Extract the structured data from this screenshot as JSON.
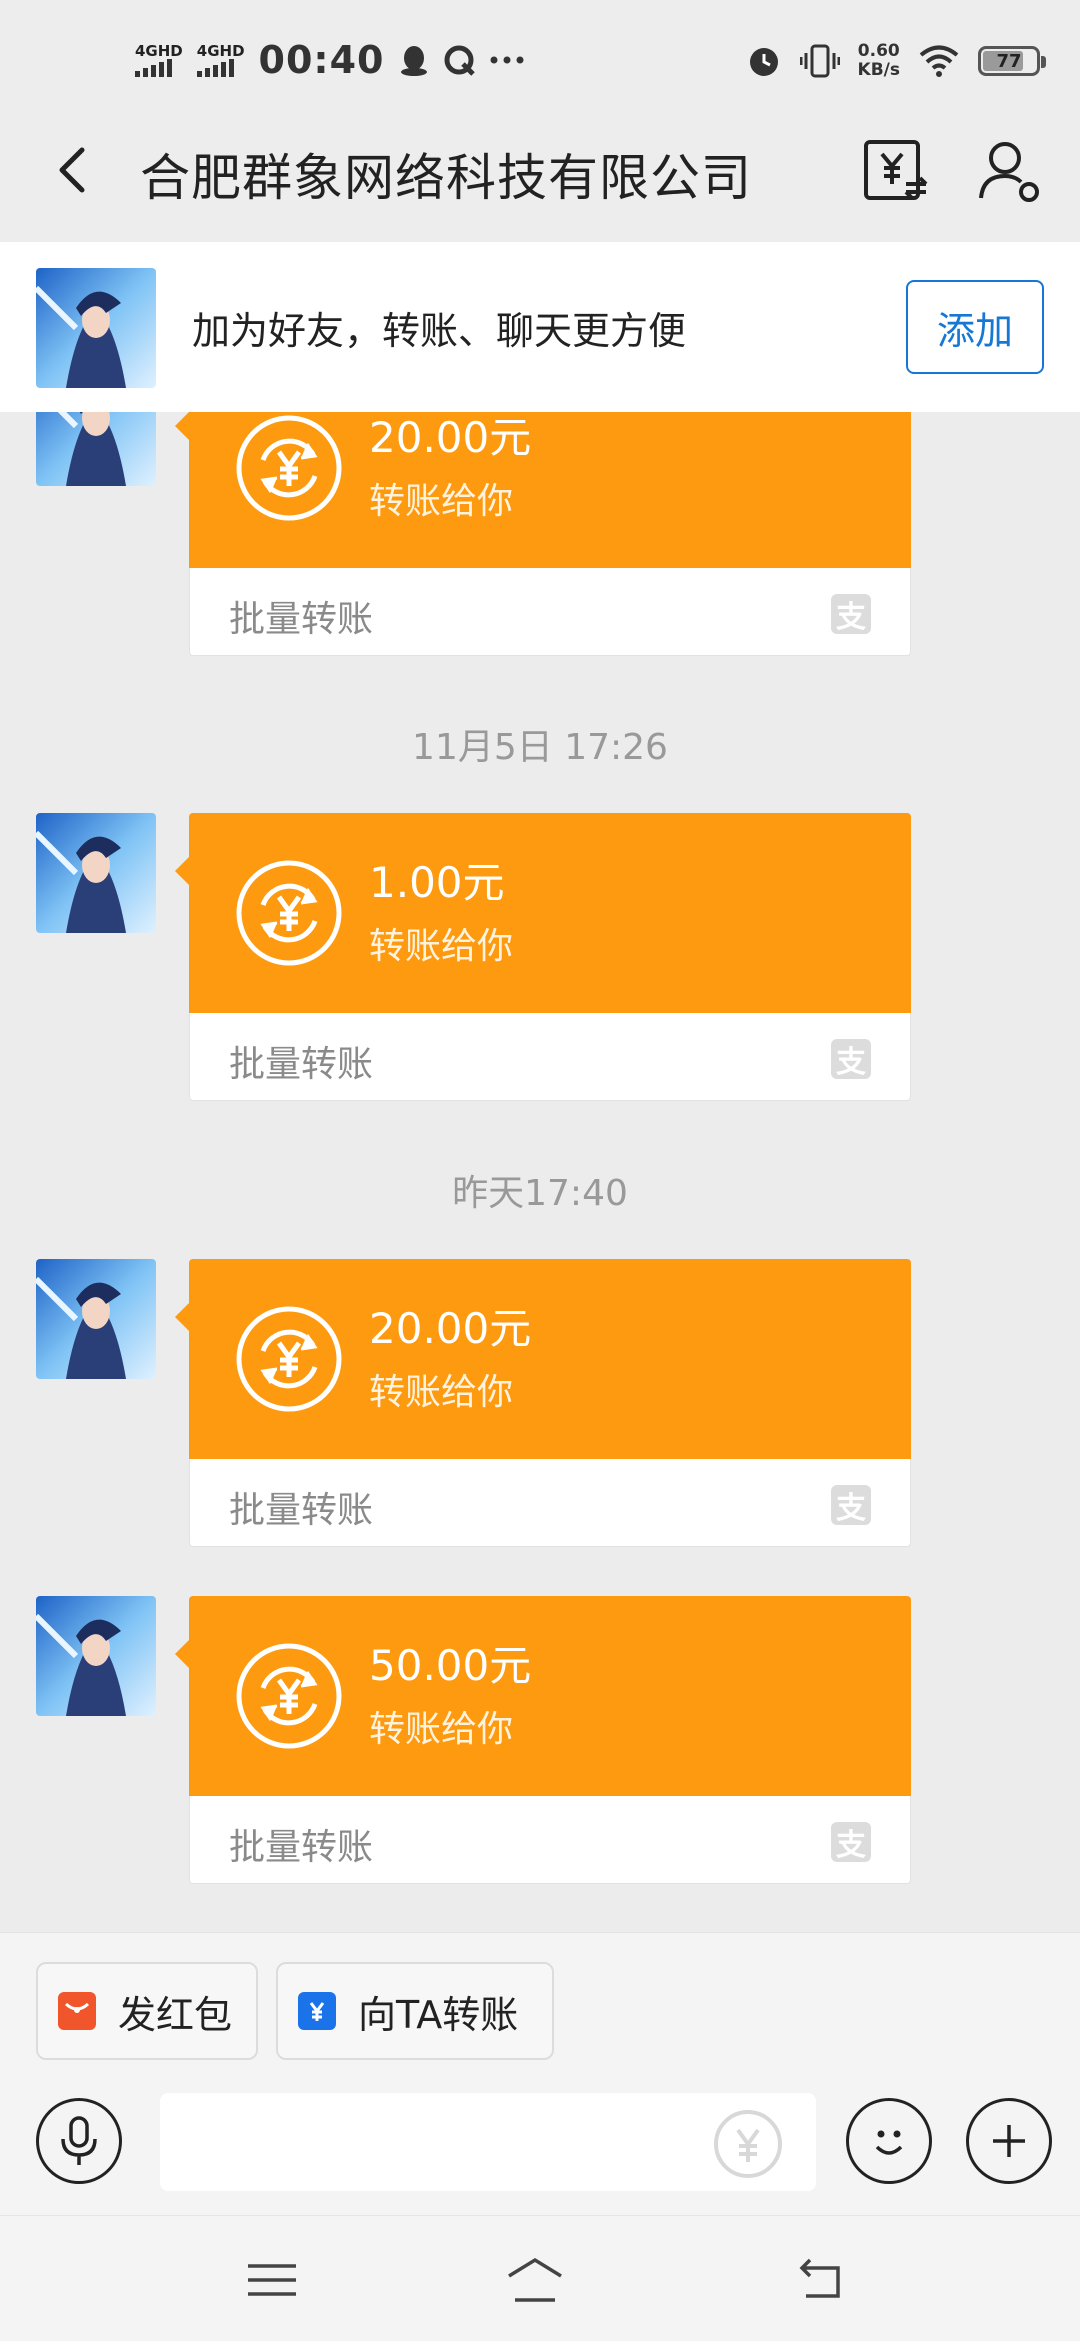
{
  "status_bar": {
    "signal1": "4GHD",
    "signal2": "4GHD",
    "time": "00:40",
    "net_speed_value": "0.60",
    "net_speed_unit": "KB/s",
    "battery": "77"
  },
  "header": {
    "title": "合肥群象网络科技有限公司"
  },
  "banner": {
    "text": "加为好友，转账、聊天更方便",
    "add_label": "添加"
  },
  "messages": [
    {
      "amount": "20.00元",
      "subtitle": "转账给你",
      "footer": "批量转账"
    },
    {
      "timestamp": "11月5日  17:26"
    },
    {
      "amount": "1.00元",
      "subtitle": "转账给你",
      "footer": "批量转账"
    },
    {
      "timestamp": "昨天17:40"
    },
    {
      "amount": "20.00元",
      "subtitle": "转账给你",
      "footer": "批量转账"
    },
    {
      "amount": "50.00元",
      "subtitle": "转账给你",
      "footer": "批量转账"
    }
  ],
  "actions": {
    "red_packet": "发红包",
    "transfer": "向TA转账"
  },
  "icons": {
    "pay_badge": "支",
    "accent": "#fd9a0f",
    "link": "#1678d4"
  }
}
